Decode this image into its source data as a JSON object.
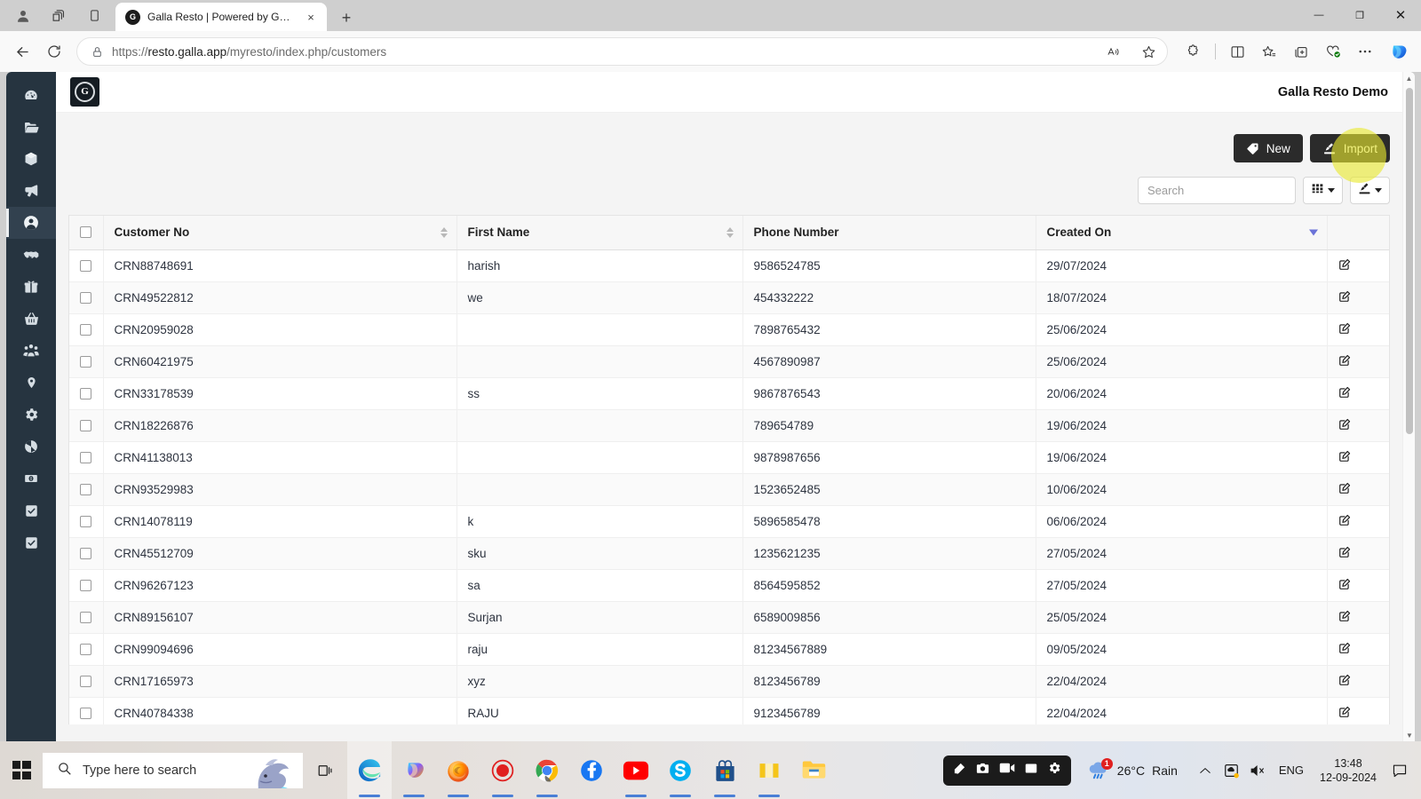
{
  "browser": {
    "tab": {
      "title": "Galla Resto | Powered by Galla",
      "favicon_letter": "G"
    },
    "new_tab_label": "+",
    "close_tab_label": "×",
    "url_scheme": "https://",
    "url_host": "resto.galla.app",
    "url_path": "/myresto/index.php/customers",
    "window_controls": {
      "minimize": "—",
      "maximize": "❐",
      "close": "✕"
    },
    "icons": {
      "profile": "profile-icon",
      "workspaces": "workspaces-icon",
      "tab_actions": "tab-actions-icon",
      "back": "back-arrow-icon",
      "refresh": "refresh-icon",
      "lock": "lock-icon",
      "read_aloud": "read-aloud-icon",
      "favorite": "star-icon",
      "extensions": "extensions-icon",
      "split_screen": "split-screen-icon",
      "favorites_bar": "favorites-icon",
      "collections": "collections-icon",
      "browser_essentials": "browser-essentials-icon",
      "settings_more": "more-options-icon",
      "copilot": "copilot-icon"
    }
  },
  "app": {
    "hamburger": "menu-icon",
    "logo_letter": "G",
    "title": "Galla Resto Demo"
  },
  "sidebar": {
    "items": [
      {
        "name": "dashboard",
        "icon": "speedometer-icon"
      },
      {
        "name": "files",
        "icon": "folder-open-icon"
      },
      {
        "name": "inventory",
        "icon": "box-icon"
      },
      {
        "name": "marketing",
        "icon": "megaphone-icon"
      },
      {
        "name": "customers",
        "icon": "person-circle-icon",
        "active": true
      },
      {
        "name": "suppliers",
        "icon": "handshake-icon"
      },
      {
        "name": "loyalty",
        "icon": "gift-icon"
      },
      {
        "name": "orders",
        "icon": "basket-icon"
      },
      {
        "name": "staff",
        "icon": "users-group-icon"
      },
      {
        "name": "locations",
        "icon": "location-pin-icon"
      },
      {
        "name": "settings",
        "icon": "gear-icon"
      },
      {
        "name": "reports",
        "icon": "pie-chart-icon"
      },
      {
        "name": "payments",
        "icon": "cash-icon"
      },
      {
        "name": "tasks",
        "icon": "checkbox-icon"
      },
      {
        "name": "approvals",
        "icon": "checkbox-icon"
      }
    ]
  },
  "toolbar": {
    "new_label": "New",
    "new_icon": "tag-icon",
    "import_label": "Import",
    "import_icon": "import-icon",
    "highlight_color": "#e8e82e"
  },
  "search": {
    "placeholder": "Search",
    "value": ""
  },
  "view_controls": {
    "columns_icon": "grid-columns-icon",
    "export_icon": "export-icon"
  },
  "table": {
    "select_all_label": "",
    "columns": [
      {
        "key": "customer_no",
        "label": "Customer No",
        "sort": "both"
      },
      {
        "key": "first_name",
        "label": "First Name",
        "sort": "both"
      },
      {
        "key": "phone_number",
        "label": "Phone Number",
        "sort": "none"
      },
      {
        "key": "created_on",
        "label": "Created On",
        "sort": "desc"
      },
      {
        "key": "actions",
        "label": "",
        "sort": "none"
      }
    ],
    "edit_icon": "edit-square-icon",
    "rows": [
      {
        "customer_no": "CRN88748691",
        "first_name": "harish",
        "phone_number": "9586524785",
        "created_on": "29/07/2024"
      },
      {
        "customer_no": "CRN49522812",
        "first_name": "we",
        "phone_number": "454332222",
        "created_on": "18/07/2024"
      },
      {
        "customer_no": "CRN20959028",
        "first_name": "",
        "phone_number": "7898765432",
        "created_on": "25/06/2024"
      },
      {
        "customer_no": "CRN60421975",
        "first_name": "",
        "phone_number": "4567890987",
        "created_on": "25/06/2024"
      },
      {
        "customer_no": "CRN33178539",
        "first_name": "ss",
        "phone_number": "9867876543",
        "created_on": "20/06/2024"
      },
      {
        "customer_no": "CRN18226876",
        "first_name": "",
        "phone_number": "789654789",
        "created_on": "19/06/2024"
      },
      {
        "customer_no": "CRN41138013",
        "first_name": "",
        "phone_number": "9878987656",
        "created_on": "19/06/2024"
      },
      {
        "customer_no": "CRN93529983",
        "first_name": "",
        "phone_number": "1523652485",
        "created_on": "10/06/2024"
      },
      {
        "customer_no": "CRN14078119",
        "first_name": "k",
        "phone_number": "5896585478",
        "created_on": "06/06/2024"
      },
      {
        "customer_no": "CRN45512709",
        "first_name": "sku",
        "phone_number": "1235621235",
        "created_on": "27/05/2024"
      },
      {
        "customer_no": "CRN96267123",
        "first_name": "sa",
        "phone_number": "8564595852",
        "created_on": "27/05/2024"
      },
      {
        "customer_no": "CRN89156107",
        "first_name": "Surjan",
        "phone_number": "6589009856",
        "created_on": "25/05/2024"
      },
      {
        "customer_no": "CRN99094696",
        "first_name": "raju",
        "phone_number": "81234567889",
        "created_on": "09/05/2024"
      },
      {
        "customer_no": "CRN17165973",
        "first_name": "xyz",
        "phone_number": "8123456789",
        "created_on": "22/04/2024"
      },
      {
        "customer_no": "CRN40784338",
        "first_name": "RAJU",
        "phone_number": "9123456789",
        "created_on": "22/04/2024"
      }
    ]
  },
  "taskbar": {
    "start_icon": "windows-start-icon",
    "search_placeholder": "Type here to search",
    "search_icon": "search-icon",
    "task_view_icon": "task-view-icon",
    "apps": [
      {
        "name": "microsoft-edge",
        "icon": "edge-icon"
      },
      {
        "name": "microsoft-copilot",
        "icon": "copilot-icon"
      },
      {
        "name": "mozilla-firefox",
        "icon": "firefox-icon"
      },
      {
        "name": "screen-recorder",
        "icon": "record-icon"
      },
      {
        "name": "google-chrome",
        "icon": "chrome-icon"
      },
      {
        "name": "facebook",
        "icon": "facebook-icon"
      },
      {
        "name": "youtube",
        "icon": "youtube-icon"
      },
      {
        "name": "skype",
        "icon": "skype-icon"
      },
      {
        "name": "microsoft-store",
        "icon": "store-icon"
      },
      {
        "name": "app-yellow",
        "icon": "yellow-app-icon"
      },
      {
        "name": "file-explorer",
        "icon": "folder-icon"
      }
    ],
    "capture_bar": {
      "icons": [
        "pen-icon",
        "camera-icon",
        "video-icon",
        "window-icon",
        "gear-icon"
      ]
    },
    "weather": {
      "temperature": "26°C",
      "condition": "Rain",
      "badge": "1",
      "icon": "rain-cloud-icon"
    },
    "tray": {
      "overflow_icon": "chevron-up-icon",
      "onedrive_icon": "onedrive-icon",
      "volume_icon": "volume-muted-icon",
      "language": "ENG"
    },
    "clock": {
      "time": "13:48",
      "date": "12-09-2024"
    },
    "notification_icon": "notification-icon"
  }
}
